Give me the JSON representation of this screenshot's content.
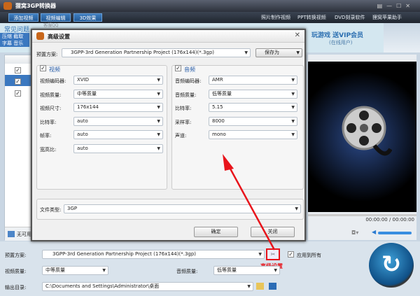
{
  "window": {
    "title": "狸窝3GP转换器",
    "controls": [
      "▤",
      "—",
      "☐",
      "✕"
    ]
  },
  "toolbar": {
    "buttons": [
      "添加视频",
      "视频编辑",
      "3D效果"
    ],
    "links": [
      "照片制作视频",
      "PPT转换视频",
      "DVD刻录软件",
      "狸窝苹果助手"
    ]
  },
  "info": {
    "faq": "常见问题",
    "row1": "压缩 截取",
    "row2": "字幕 音乐",
    "promo": "玩游戏 送VIP会员",
    "promo_sub": "(在线用户)",
    "faded": "客服QQ"
  },
  "list": {
    "status": "无可用"
  },
  "player": {
    "time": "00:00:00 / 00:00:00"
  },
  "bottom": {
    "preset_label": "预置方案:",
    "preset_value": "3GPP-3rd Generation Partnership Project (176x144)(*.3gp)",
    "apply_all": "应用到所有",
    "video_quality_label": "视频质量:",
    "video_quality": "中等质量",
    "audio_quality_label": "音频质量:",
    "audio_quality": "低等质量",
    "output_label": "输出目录:",
    "output_value": "C:\\Documents and Settings\\Administrator\\桌面"
  },
  "annotation": {
    "text": "高级设置",
    "color": "#e8141b"
  },
  "dialog": {
    "title": "高级设置",
    "preset_label": "预置方案:",
    "preset_value": "3GPP-3rd Generation Partnership Project (176x144)(*.3gp)",
    "save_as": "保存为",
    "video": {
      "title": "视频",
      "fields": [
        {
          "label": "视频编码器:",
          "value": "XVID"
        },
        {
          "label": "视频质量:",
          "value": "中等质量"
        },
        {
          "label": "视频尺寸:",
          "value": "176x144"
        },
        {
          "label": "比特率:",
          "value": "auto"
        },
        {
          "label": "帧率:",
          "value": "auto"
        },
        {
          "label": "宽高比:",
          "value": "auto"
        }
      ]
    },
    "audio": {
      "title": "音频",
      "fields": [
        {
          "label": "音频编码器:",
          "value": "AMR"
        },
        {
          "label": "音频质量:",
          "value": "低等质量"
        },
        {
          "label": "比特率:",
          "value": "5.15"
        },
        {
          "label": "采样率:",
          "value": "8000"
        },
        {
          "label": "声道:",
          "value": "mono"
        }
      ]
    },
    "filetype_label": "文件类型:",
    "filetype_value": "3GP",
    "ok": "确定",
    "close": "关闭"
  }
}
